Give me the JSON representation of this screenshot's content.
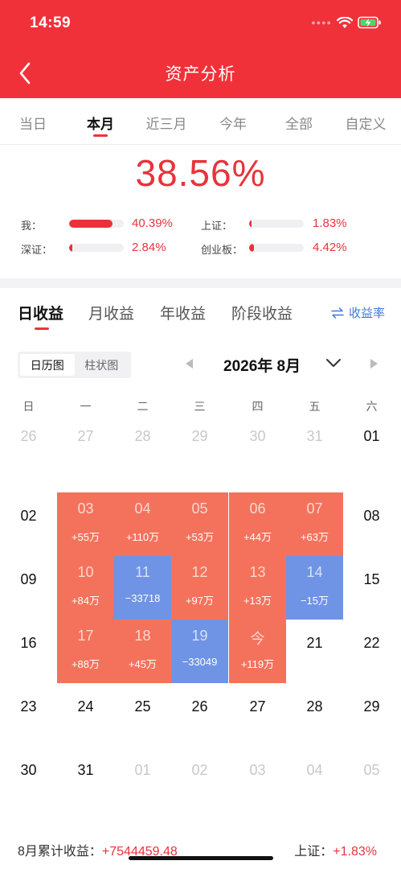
{
  "status": {
    "time": "14:59"
  },
  "nav": {
    "title": "资产分析"
  },
  "period_tabs": [
    {
      "label": "当日",
      "active": false
    },
    {
      "label": "本月",
      "active": true
    },
    {
      "label": "近三月",
      "active": false
    },
    {
      "label": "今年",
      "active": false
    },
    {
      "label": "全部",
      "active": false
    },
    {
      "label": "自定义",
      "active": false
    }
  ],
  "total_return": "38.56%",
  "benchmarks": [
    {
      "label": "我：",
      "value": "40.39%",
      "fill_percent": 80
    },
    {
      "label": "上证：",
      "value": "1.83%",
      "fill_percent": 4
    },
    {
      "label": "深证：",
      "value": "2.84%",
      "fill_percent": 6
    },
    {
      "label": "创业板：",
      "value": "4.42%",
      "fill_percent": 9
    }
  ],
  "income_tabs": [
    {
      "label": "日收益",
      "active": true
    },
    {
      "label": "月收益",
      "active": false
    },
    {
      "label": "年收益",
      "active": false
    },
    {
      "label": "阶段收益",
      "active": false
    }
  ],
  "rate_link": {
    "label": "收益率"
  },
  "view_toggle": [
    {
      "label": "日历图",
      "active": true
    },
    {
      "label": "柱状图",
      "active": false
    }
  ],
  "calendar": {
    "month_title": "2026年 8月",
    "weekdays": [
      "日",
      "一",
      "二",
      "三",
      "四",
      "五",
      "六"
    ],
    "weeks": [
      [
        {
          "d": "26",
          "t": "muted"
        },
        {
          "d": "27",
          "t": "muted"
        },
        {
          "d": "28",
          "t": "muted"
        },
        {
          "d": "29",
          "t": "muted"
        },
        {
          "d": "30",
          "t": "muted"
        },
        {
          "d": "31",
          "t": "muted"
        },
        {
          "d": "01",
          "t": "plain"
        }
      ],
      [
        {
          "d": "02",
          "t": "plain"
        },
        {
          "d": "03",
          "t": "gain",
          "a": "+55万"
        },
        {
          "d": "04",
          "t": "gain",
          "a": "+110万"
        },
        {
          "d": "05",
          "t": "gain",
          "a": "+53万"
        },
        {
          "d": "06",
          "t": "gain",
          "a": "+44万"
        },
        {
          "d": "07",
          "t": "gain",
          "a": "+63万"
        },
        {
          "d": "08",
          "t": "plain"
        }
      ],
      [
        {
          "d": "09",
          "t": "plain"
        },
        {
          "d": "10",
          "t": "gain",
          "a": "+84万"
        },
        {
          "d": "11",
          "t": "loss",
          "a": "−33718"
        },
        {
          "d": "12",
          "t": "gain",
          "a": "+97万"
        },
        {
          "d": "13",
          "t": "gain",
          "a": "+13万"
        },
        {
          "d": "14",
          "t": "loss",
          "a": "−15万"
        },
        {
          "d": "15",
          "t": "plain"
        }
      ],
      [
        {
          "d": "16",
          "t": "plain"
        },
        {
          "d": "17",
          "t": "gain",
          "a": "+88万"
        },
        {
          "d": "18",
          "t": "gain",
          "a": "+45万"
        },
        {
          "d": "19",
          "t": "loss",
          "a": "−33049"
        },
        {
          "d": "今",
          "t": "gain",
          "a": "+119万"
        },
        {
          "d": "21",
          "t": "plain"
        },
        {
          "d": "22",
          "t": "plain"
        }
      ],
      [
        {
          "d": "23",
          "t": "plain"
        },
        {
          "d": "24",
          "t": "plain"
        },
        {
          "d": "25",
          "t": "plain"
        },
        {
          "d": "26",
          "t": "plain"
        },
        {
          "d": "27",
          "t": "plain"
        },
        {
          "d": "28",
          "t": "plain"
        },
        {
          "d": "29",
          "t": "plain"
        }
      ],
      [
        {
          "d": "30",
          "t": "plain"
        },
        {
          "d": "31",
          "t": "plain"
        },
        {
          "d": "01",
          "t": "muted"
        },
        {
          "d": "02",
          "t": "muted"
        },
        {
          "d": "03",
          "t": "muted"
        },
        {
          "d": "04",
          "t": "muted"
        },
        {
          "d": "05",
          "t": "muted"
        }
      ]
    ]
  },
  "summary": {
    "month_label": "8月累计收益：",
    "month_value": "+7544459.48",
    "bench_label": "上证：",
    "bench_value": "+1.83%"
  },
  "colors": {
    "brand_red": "#f0313a",
    "gain": "#f4725c",
    "loss": "#6f94e6",
    "link_blue": "#3d7ad8"
  },
  "icons": [
    "wifi-icon",
    "battery-charging-icon",
    "back-arrow-icon",
    "swap-arrows-icon",
    "chevron-down-icon",
    "triangle-left-icon",
    "triangle-right-icon"
  ]
}
